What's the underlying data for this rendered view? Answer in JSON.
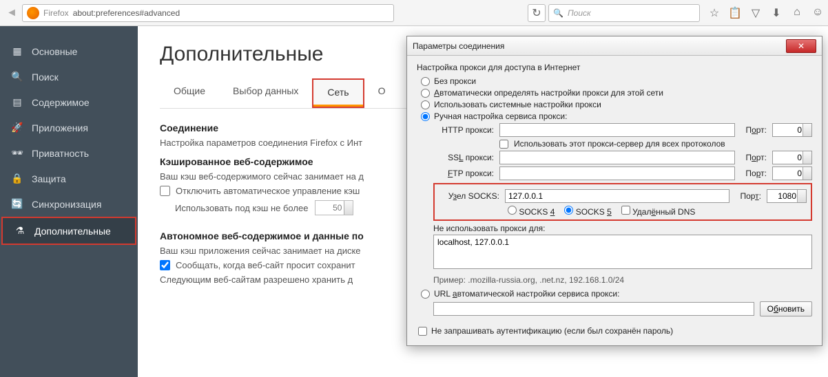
{
  "topbar": {
    "firefox_label": "Firefox",
    "url": "about:preferences#advanced",
    "search_placeholder": "Поиск"
  },
  "sidebar": {
    "items": [
      {
        "label": "Основные"
      },
      {
        "label": "Поиск"
      },
      {
        "label": "Содержимое"
      },
      {
        "label": "Приложения"
      },
      {
        "label": "Приватность"
      },
      {
        "label": "Защита"
      },
      {
        "label": "Синхронизация"
      },
      {
        "label": "Дополнительные"
      }
    ]
  },
  "content": {
    "title": "Дополнительные",
    "tabs": {
      "general": "Общие",
      "data": "Выбор данных",
      "network": "Сеть",
      "other_partial": "О"
    },
    "conn_h": "Соединение",
    "conn_p": "Настройка параметров соединения Firefox с Инт",
    "cache_h": "Кэшированное веб-содержимое",
    "cache_p": "Ваш кэш веб-содержимого сейчас занимает на д",
    "cache_chk": "Отключить автоматическое управление кэш",
    "cache_limit_label": "Использовать под кэш не более",
    "cache_limit_value": "50",
    "offline_h": "Автономное веб-содержимое и данные по",
    "offline_p": "Ваш кэш приложения сейчас занимает на диске",
    "offline_chk": "Сообщать, когда веб-сайт просит сохранит",
    "offline_p2": "Следующим веб-сайтам разрешено хранить д"
  },
  "dialog": {
    "title": "Параметры соединения",
    "heading": "Настройка прокси для доступа в Интернет",
    "r_none": "Без прокси",
    "r_auto": "Автоматически определять настройки прокси для этой сети",
    "r_sys": "Использовать системные настройки прокси",
    "r_manual": "Ручная настройка сервиса прокси:",
    "http_label": "HTTP прокси:",
    "use_for_all": "Использовать этот прокси-сервер для всех протоколов",
    "ssl_label": "SSL прокси:",
    "ftp_label": "FTP прокси:",
    "socks_label": "Узел SOCKS:",
    "socks_host": "127.0.0.1",
    "port_label": "Порт:",
    "port0": "0",
    "socks_port": "1080",
    "socks4": "SOCKS 4",
    "socks5": "SOCKS 5",
    "remote_dns": "Удалённый DNS",
    "noproxy_label": "Не использовать прокси для:",
    "noproxy_value": "localhost, 127.0.0.1",
    "example": "Пример: .mozilla-russia.org, .net.nz, 192.168.1.0/24",
    "r_url": "URL автоматической настройки сервиса прокси:",
    "reload_btn": "Обновить",
    "no_auth": "Не запрашивать аутентификацию (если был сохранён пароль)"
  }
}
